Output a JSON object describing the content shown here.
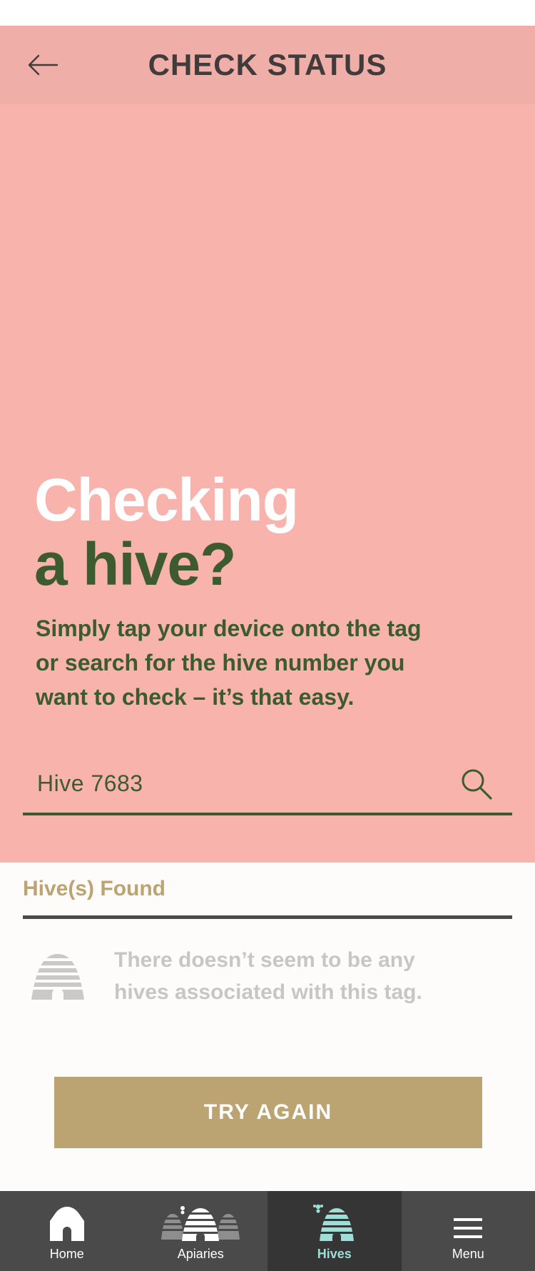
{
  "header": {
    "title": "CHECK STATUS",
    "back_icon": "arrow-left-icon"
  },
  "hero": {
    "title_line1": "Checking",
    "title_line2": "a hive?",
    "description": "Simply tap your device onto the tag or search for the hive number you want to check – it’s that easy."
  },
  "search": {
    "value": "Hive 7683",
    "icon": "search-icon"
  },
  "results": {
    "title": "Hive(s) Found",
    "empty_icon": "beehive-icon",
    "empty_message": "There doesn’t seem to be any hives associated with this tag."
  },
  "actions": {
    "try_again_label": "TRY AGAIN"
  },
  "tabbar": {
    "active": "Hives",
    "items": [
      {
        "label": "Home",
        "icon": "home-icon"
      },
      {
        "label": "Apiaries",
        "icon": "apiaries-icon"
      },
      {
        "label": "Hives",
        "icon": "hive-icon"
      },
      {
        "label": "Menu",
        "icon": "menu-icon"
      }
    ]
  },
  "colors": {
    "appbar_bg": "#efaea7",
    "hero_bg": "#f8b3ac",
    "hero_green": "#3e5b2f",
    "gold": "#bca472",
    "tabbar_bg": "#4a4a4a",
    "tab_active_bg": "#353535",
    "tab_active_fg": "#9fded8"
  }
}
